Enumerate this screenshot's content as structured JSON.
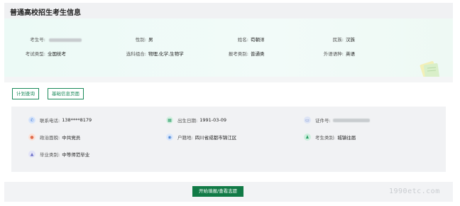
{
  "header": {
    "title": "普通高校招生考生信息"
  },
  "info": {
    "candidate_no_label": "考生号:",
    "gender_label": "性别:",
    "gender_value": "男",
    "name_label": "姓名:",
    "name_value": "苟朝洋",
    "ethnicity_label": "民族:",
    "ethnicity_value": "汉族",
    "exam_type_label": "考试类型:",
    "exam_type_value": "全国统考",
    "subjects_label": "选科组合:",
    "subjects_value": "物理,化学,生物学",
    "category_label": "报考类别:",
    "category_value": "普通类",
    "language_label": "外语语种:",
    "language_value": "英语"
  },
  "actions": {
    "plan_query": "计划查询",
    "basic_info": "基础信息页面"
  },
  "details": {
    "phone_label": "联系电话:",
    "phone_value": "138****8179",
    "birth_label": "出生日期:",
    "birth_value": "1991-03-09",
    "id_label": "证件号:",
    "political_label": "政治面貌:",
    "political_value": "中共党员",
    "hukou_label": "户籍地:",
    "hukou_value": "四川省成都市锦江区",
    "type_label": "考生类别:",
    "type_value": "城镇往届",
    "grad_label": "毕业类别:",
    "grad_value": "中等师范毕业"
  },
  "footer": {
    "start_button": "开始填报/查看志愿",
    "watermark": "1990etc.com"
  },
  "icons": {
    "phone": "phone-icon",
    "birth": "calendar-icon",
    "id": "id-card-icon",
    "political": "badge-icon",
    "hukou": "person-icon",
    "type": "user-icon",
    "grad": "graduation-icon"
  },
  "colors": {
    "accent": "#117a46",
    "accent_border": "#1b8a5a"
  }
}
